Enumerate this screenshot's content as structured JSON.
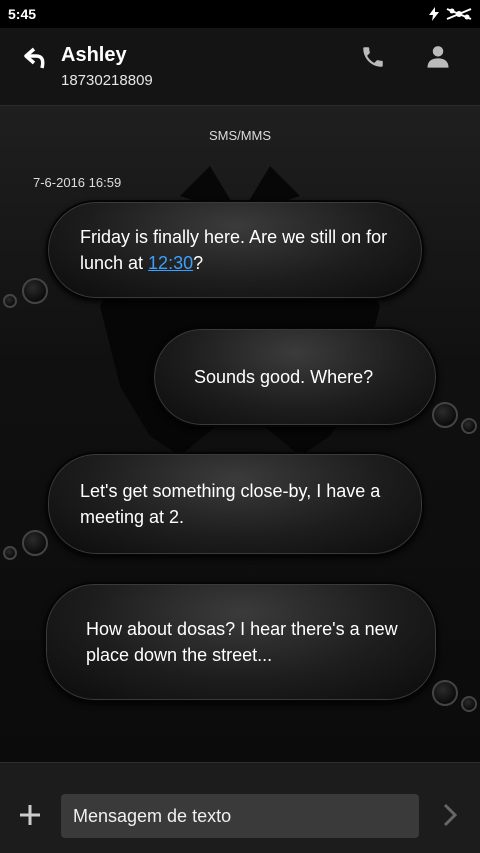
{
  "status_bar": {
    "time": "5:45"
  },
  "header": {
    "contact_name": "Ashley",
    "contact_number": "18730218809"
  },
  "conversation": {
    "type_label": "SMS/MMS",
    "timestamp": "7-6-2016 16:59",
    "messages": [
      {
        "direction": "incoming",
        "text_before": "Friday is finally here. Are we still on for lunch at ",
        "link": "12:30",
        "text_after": "?"
      },
      {
        "direction": "outgoing",
        "text": "Sounds good. Where?"
      },
      {
        "direction": "incoming",
        "text": "Let's get something close-by, I have a meeting at 2."
      },
      {
        "direction": "outgoing",
        "text": "How about dosas? I hear there's a new place down the street..."
      }
    ]
  },
  "composer": {
    "placeholder": "Mensagem de texto"
  },
  "icons": {
    "back": "back-arrow-icon",
    "call": "phone-icon",
    "contact": "person-icon",
    "add": "plus-icon",
    "send": "chevron-right-icon",
    "status": [
      "charging-icon",
      "signal-icon"
    ]
  },
  "colors": {
    "link": "#3aa0ff",
    "background": "#0d0d0d",
    "input": "#3a3a3a"
  }
}
